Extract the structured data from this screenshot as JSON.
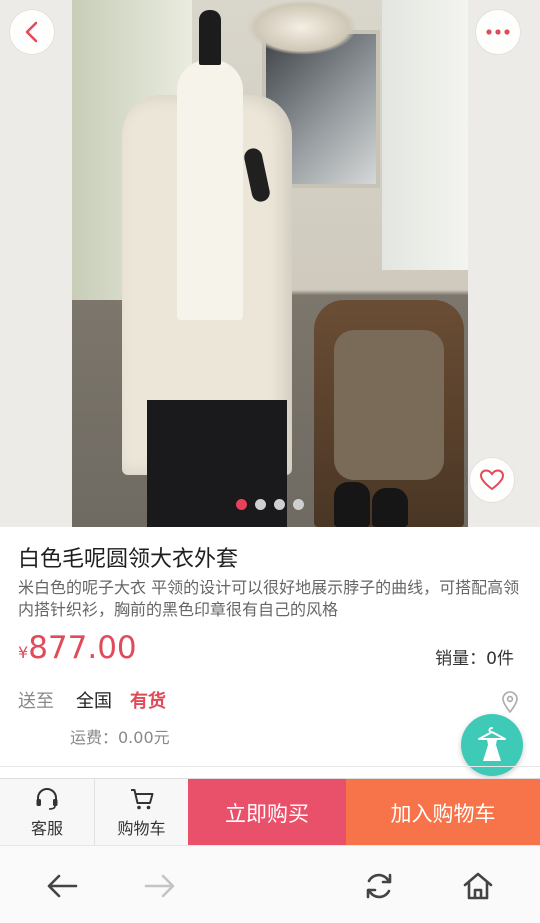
{
  "product": {
    "title": "白色毛呢圆领大衣外套",
    "description": "米白色的呢子大衣 平领的设计可以很好地展示脖子的曲线，可搭配高领内搭针织衫，胸前的黑色印章很有自己的风格",
    "price_currency": "¥",
    "price": "877.00",
    "sales": "销量：0件"
  },
  "carousel": {
    "dots": 4,
    "active_index": 0
  },
  "shipping": {
    "label": "送至",
    "region": "全国",
    "stock": "有货",
    "freight": "运费：0.00元"
  },
  "bottom_bar": {
    "service_label": "客服",
    "cart_label": "购物车",
    "buy_now": "立即购买",
    "add_to_cart": "加入购物车"
  },
  "icons": {
    "back": "chevron-left-icon",
    "more": "more-dots-icon",
    "favorite": "heart-icon",
    "location": "location-pin-icon",
    "wardrobe": "dress-hanger-icon",
    "service": "headset-icon",
    "cart": "cart-icon",
    "nav_back": "arrow-left-icon",
    "nav_forward": "arrow-right-icon",
    "refresh": "refresh-icon",
    "home": "home-icon"
  },
  "colors": {
    "accent": "#e14a59",
    "buy": "#e9506a",
    "cart": "#f7744a",
    "float": "#3fc9b7"
  }
}
